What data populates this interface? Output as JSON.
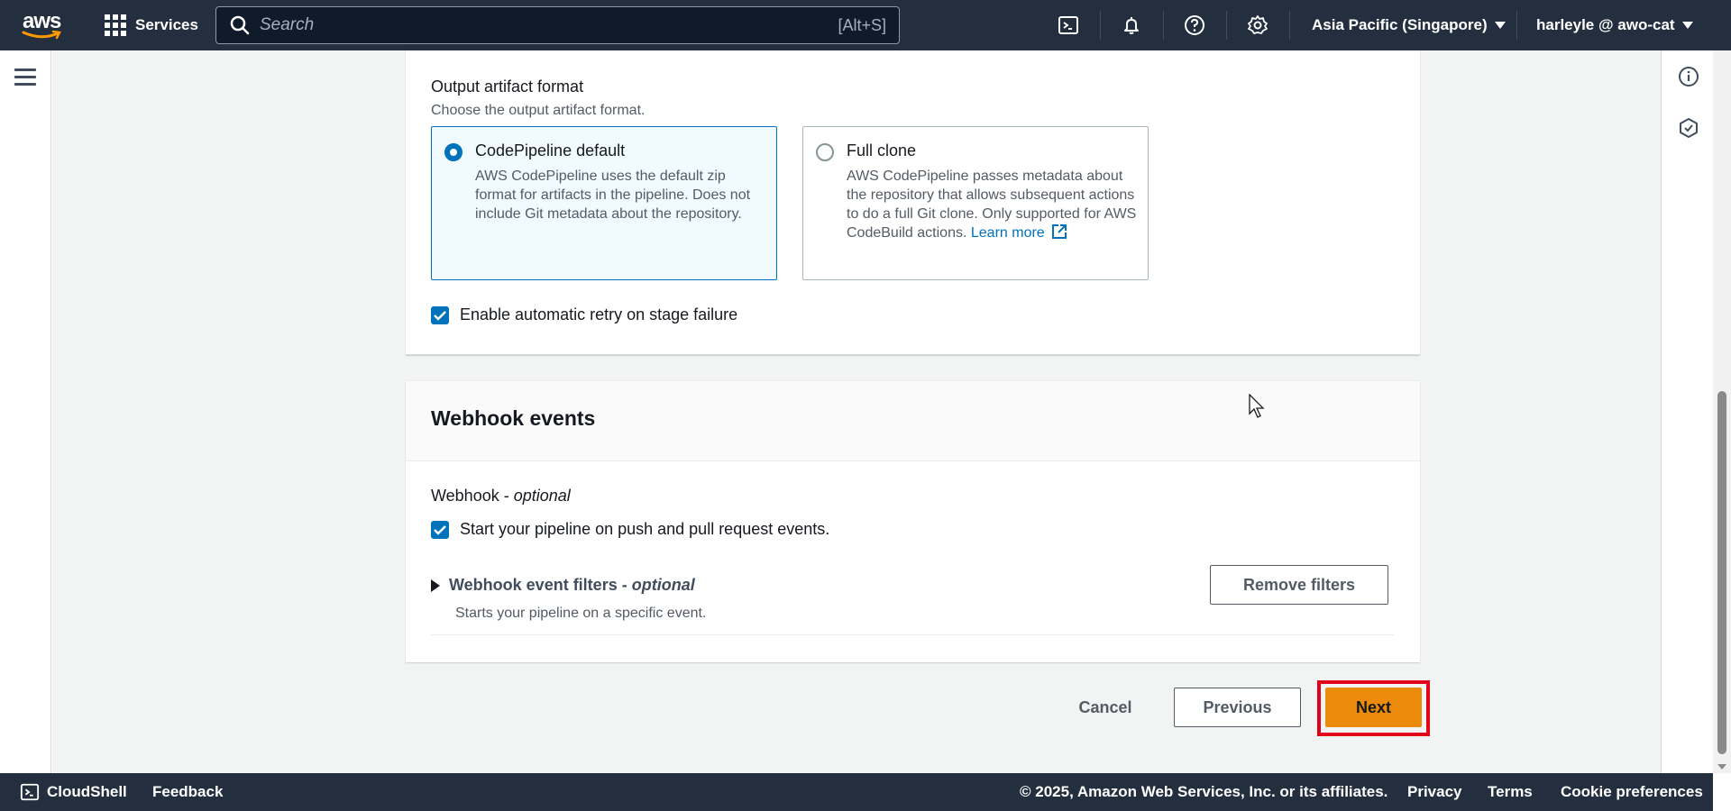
{
  "topnav": {
    "logo_text": "aws",
    "services_label": "Services",
    "search_placeholder": "Search",
    "search_shortcut": "[Alt+S]",
    "region_label": "Asia Pacific (Singapore)",
    "user_label": "harleyle @ awo-cat",
    "icons": [
      "cloudshell-icon",
      "bell-icon",
      "help-icon",
      "settings-icon"
    ]
  },
  "output_artifact": {
    "label": "Output artifact format",
    "description": "Choose the output artifact format.",
    "options": [
      {
        "title": "CodePipeline default",
        "description": "AWS CodePipeline uses the default zip format for artifacts in the pipeline. Does not include Git metadata about the repository.",
        "selected": true
      },
      {
        "title": "Full clone",
        "description": "AWS CodePipeline passes metadata about the repository that allows subsequent actions to do a full Git clone. Only supported for AWS CodeBuild actions.",
        "link_text": "Learn more",
        "selected": false
      }
    ],
    "retry_label": "Enable automatic retry on stage failure",
    "retry_checked": true
  },
  "webhook": {
    "title": "Webhook events",
    "label": "Webhook",
    "label_optional": "optional",
    "push_label": "Start your pipeline on push and pull request events.",
    "push_checked": true,
    "filters_label": "Webhook event filters",
    "filters_optional": "optional",
    "filters_description": "Starts your pipeline on a specific event.",
    "remove_filters_label": "Remove filters"
  },
  "actions": {
    "cancel_label": "Cancel",
    "previous_label": "Previous",
    "next_label": "Next"
  },
  "footer": {
    "cloudshell_label": "CloudShell",
    "feedback_label": "Feedback",
    "copyright": "© 2025, Amazon Web Services, Inc. or its affiliates.",
    "privacy_label": "Privacy",
    "terms_label": "Terms",
    "cookie_label": "Cookie preferences"
  },
  "colors": {
    "nav_bg": "#232f3e",
    "accent_blue": "#0073bb",
    "primary_orange": "#ec8a0c",
    "highlight_red": "#e3001b"
  }
}
